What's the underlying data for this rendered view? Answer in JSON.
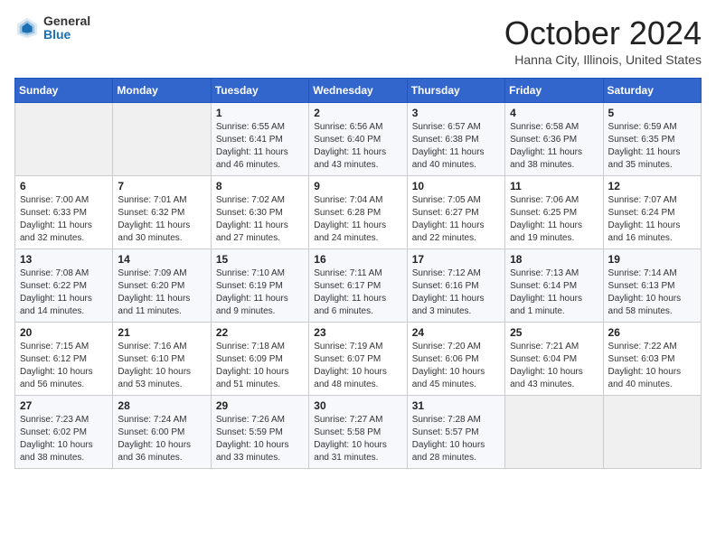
{
  "header": {
    "logo_general": "General",
    "logo_blue": "Blue",
    "month_title": "October 2024",
    "location": "Hanna City, Illinois, United States"
  },
  "weekdays": [
    "Sunday",
    "Monday",
    "Tuesday",
    "Wednesday",
    "Thursday",
    "Friday",
    "Saturday"
  ],
  "weeks": [
    [
      {
        "day": "",
        "info": ""
      },
      {
        "day": "",
        "info": ""
      },
      {
        "day": "1",
        "info": "Sunrise: 6:55 AM\nSunset: 6:41 PM\nDaylight: 11 hours and 46 minutes."
      },
      {
        "day": "2",
        "info": "Sunrise: 6:56 AM\nSunset: 6:40 PM\nDaylight: 11 hours and 43 minutes."
      },
      {
        "day": "3",
        "info": "Sunrise: 6:57 AM\nSunset: 6:38 PM\nDaylight: 11 hours and 40 minutes."
      },
      {
        "day": "4",
        "info": "Sunrise: 6:58 AM\nSunset: 6:36 PM\nDaylight: 11 hours and 38 minutes."
      },
      {
        "day": "5",
        "info": "Sunrise: 6:59 AM\nSunset: 6:35 PM\nDaylight: 11 hours and 35 minutes."
      }
    ],
    [
      {
        "day": "6",
        "info": "Sunrise: 7:00 AM\nSunset: 6:33 PM\nDaylight: 11 hours and 32 minutes."
      },
      {
        "day": "7",
        "info": "Sunrise: 7:01 AM\nSunset: 6:32 PM\nDaylight: 11 hours and 30 minutes."
      },
      {
        "day": "8",
        "info": "Sunrise: 7:02 AM\nSunset: 6:30 PM\nDaylight: 11 hours and 27 minutes."
      },
      {
        "day": "9",
        "info": "Sunrise: 7:04 AM\nSunset: 6:28 PM\nDaylight: 11 hours and 24 minutes."
      },
      {
        "day": "10",
        "info": "Sunrise: 7:05 AM\nSunset: 6:27 PM\nDaylight: 11 hours and 22 minutes."
      },
      {
        "day": "11",
        "info": "Sunrise: 7:06 AM\nSunset: 6:25 PM\nDaylight: 11 hours and 19 minutes."
      },
      {
        "day": "12",
        "info": "Sunrise: 7:07 AM\nSunset: 6:24 PM\nDaylight: 11 hours and 16 minutes."
      }
    ],
    [
      {
        "day": "13",
        "info": "Sunrise: 7:08 AM\nSunset: 6:22 PM\nDaylight: 11 hours and 14 minutes."
      },
      {
        "day": "14",
        "info": "Sunrise: 7:09 AM\nSunset: 6:20 PM\nDaylight: 11 hours and 11 minutes."
      },
      {
        "day": "15",
        "info": "Sunrise: 7:10 AM\nSunset: 6:19 PM\nDaylight: 11 hours and 9 minutes."
      },
      {
        "day": "16",
        "info": "Sunrise: 7:11 AM\nSunset: 6:17 PM\nDaylight: 11 hours and 6 minutes."
      },
      {
        "day": "17",
        "info": "Sunrise: 7:12 AM\nSunset: 6:16 PM\nDaylight: 11 hours and 3 minutes."
      },
      {
        "day": "18",
        "info": "Sunrise: 7:13 AM\nSunset: 6:14 PM\nDaylight: 11 hours and 1 minute."
      },
      {
        "day": "19",
        "info": "Sunrise: 7:14 AM\nSunset: 6:13 PM\nDaylight: 10 hours and 58 minutes."
      }
    ],
    [
      {
        "day": "20",
        "info": "Sunrise: 7:15 AM\nSunset: 6:12 PM\nDaylight: 10 hours and 56 minutes."
      },
      {
        "day": "21",
        "info": "Sunrise: 7:16 AM\nSunset: 6:10 PM\nDaylight: 10 hours and 53 minutes."
      },
      {
        "day": "22",
        "info": "Sunrise: 7:18 AM\nSunset: 6:09 PM\nDaylight: 10 hours and 51 minutes."
      },
      {
        "day": "23",
        "info": "Sunrise: 7:19 AM\nSunset: 6:07 PM\nDaylight: 10 hours and 48 minutes."
      },
      {
        "day": "24",
        "info": "Sunrise: 7:20 AM\nSunset: 6:06 PM\nDaylight: 10 hours and 45 minutes."
      },
      {
        "day": "25",
        "info": "Sunrise: 7:21 AM\nSunset: 6:04 PM\nDaylight: 10 hours and 43 minutes."
      },
      {
        "day": "26",
        "info": "Sunrise: 7:22 AM\nSunset: 6:03 PM\nDaylight: 10 hours and 40 minutes."
      }
    ],
    [
      {
        "day": "27",
        "info": "Sunrise: 7:23 AM\nSunset: 6:02 PM\nDaylight: 10 hours and 38 minutes."
      },
      {
        "day": "28",
        "info": "Sunrise: 7:24 AM\nSunset: 6:00 PM\nDaylight: 10 hours and 36 minutes."
      },
      {
        "day": "29",
        "info": "Sunrise: 7:26 AM\nSunset: 5:59 PM\nDaylight: 10 hours and 33 minutes."
      },
      {
        "day": "30",
        "info": "Sunrise: 7:27 AM\nSunset: 5:58 PM\nDaylight: 10 hours and 31 minutes."
      },
      {
        "day": "31",
        "info": "Sunrise: 7:28 AM\nSunset: 5:57 PM\nDaylight: 10 hours and 28 minutes."
      },
      {
        "day": "",
        "info": ""
      },
      {
        "day": "",
        "info": ""
      }
    ]
  ]
}
